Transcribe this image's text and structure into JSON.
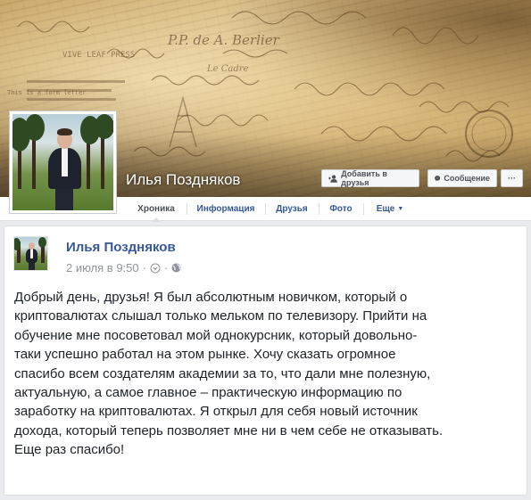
{
  "profile": {
    "name": "Илья Поздняков",
    "cover_inscriptions": [
      "P.P. de A. Berlier",
      "VIVE LEAF PRESS",
      "This is a form letter",
      "Le Cadre"
    ]
  },
  "cover_actions": {
    "add_friend_label": "Добавить в друзья",
    "message_label": "Сообщение",
    "more_label": "···"
  },
  "nav": {
    "tabs": [
      {
        "label": "Хроника"
      },
      {
        "label": "Информация"
      },
      {
        "label": "Друзья"
      },
      {
        "label": "Фото"
      },
      {
        "label": "Еще"
      }
    ],
    "more_caret": "▼"
  },
  "post": {
    "author": "Илья Поздняков",
    "date": "2 июля в 9:50",
    "dot": "·",
    "text": "Добрый день, друзья! Я был абсолютным новичком, который о\nкриптовалютах слышал только мельком по телевизору. Прийти на\nобучение мне посоветовал мой однокурсник, который довольно-\nтаки успешно работал на этом рынке. Хочу сказать огромное\nспасибо всем создателям академии за то, что дали мне полезную,\nактуальную, а самое главное – практическую информацию по\nзаработку на криптовалютах. Я открыл для себя новый источник\nдохода, который теперь позволяет мне ни в чем себе не отказывать.\nЕще раз спасибо!"
  },
  "colors": {
    "link": "#365899",
    "meta": "#90949c",
    "page_bg": "#e9ebee"
  },
  "icons": {
    "add_friend": "add-friend-icon",
    "message": "messenger-icon",
    "privacy": "globe-icon",
    "chevron": "chevron-down-circle-icon"
  }
}
